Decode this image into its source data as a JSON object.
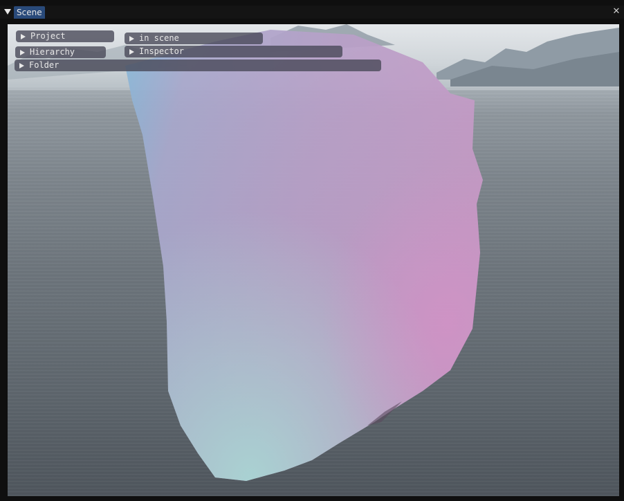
{
  "window": {
    "tab_label": "Scene",
    "collapse_icon": "triangle-down-icon",
    "close_icon": "close-icon",
    "close_glyph": "✕"
  },
  "panels": [
    {
      "id": "project",
      "label": "Project",
      "icon": "triangle-right-icon"
    },
    {
      "id": "in-scene",
      "label": "in scene",
      "icon": "triangle-right-icon"
    },
    {
      "id": "hierarchy",
      "label": "Hierarchy",
      "icon": "triangle-right-icon"
    },
    {
      "id": "inspector",
      "label": "Inspector",
      "icon": "triangle-right-icon"
    },
    {
      "id": "folder",
      "label": "Folder",
      "icon": "triangle-right-icon"
    }
  ],
  "colors": {
    "tab_active": "#294a7a",
    "panel_bg": "#464656",
    "shape_pink": "#c8a0c8",
    "shape_cyan": "#9ccfd8"
  }
}
